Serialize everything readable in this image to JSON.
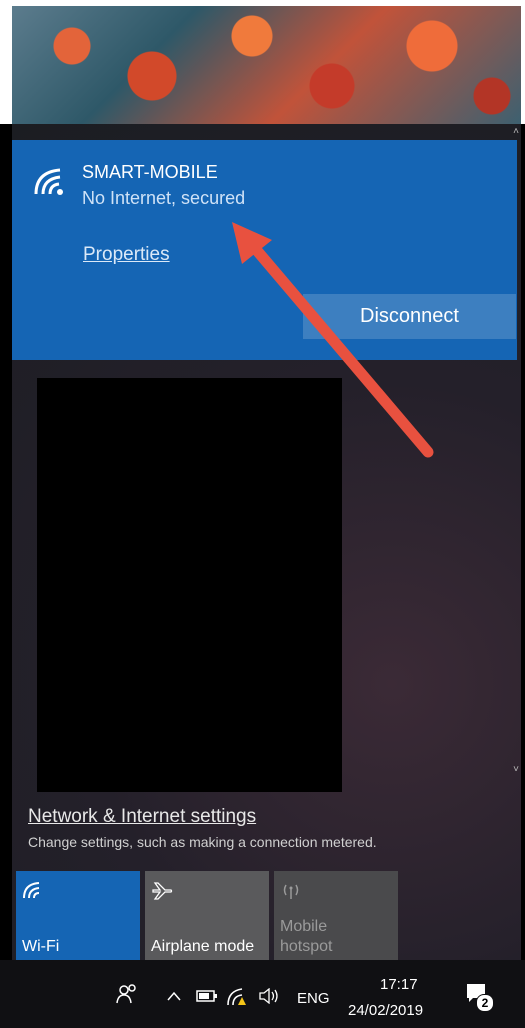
{
  "network": {
    "ssid": "SMART-MOBILE",
    "status": "No Internet, secured",
    "properties_label": "Properties",
    "disconnect_label": "Disconnect"
  },
  "settings": {
    "link_label": "Network & Internet settings",
    "description": "Change settings, such as making a connection metered."
  },
  "quick_actions": [
    {
      "label": "Wi-Fi",
      "icon": "wifi-icon",
      "active": true
    },
    {
      "label": "Airplane mode",
      "icon": "airplane-icon",
      "active": false
    },
    {
      "label": "Mobile hotspot",
      "icon": "hotspot-icon",
      "active": false,
      "disabled": true
    }
  ],
  "taskbar": {
    "language": "ENG",
    "time": "17:17",
    "date": "24/02/2019",
    "notification_count": "2"
  },
  "colors": {
    "accent": "#1565b4",
    "annotation_arrow": "#e8513f"
  }
}
